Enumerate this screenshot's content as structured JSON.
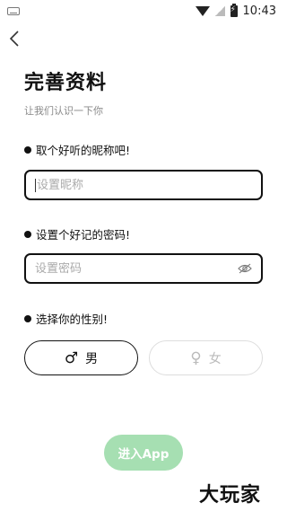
{
  "status_bar": {
    "time": "10:43"
  },
  "header": {
    "title": "完善资料",
    "subtitle": "让我们认识一下你"
  },
  "nickname": {
    "label": "取个好听的昵称吧!",
    "placeholder": "设置昵称"
  },
  "password": {
    "label": "设置个好记的密码!",
    "placeholder": "设置密码"
  },
  "gender": {
    "label": "选择你的性别!",
    "male": "男",
    "female": "女",
    "male_symbol": "♂",
    "female_symbol": "♀"
  },
  "enter_button": {
    "label": "进入App",
    "color": "#a6dfb2"
  },
  "watermark": {
    "text": "大玩家"
  }
}
